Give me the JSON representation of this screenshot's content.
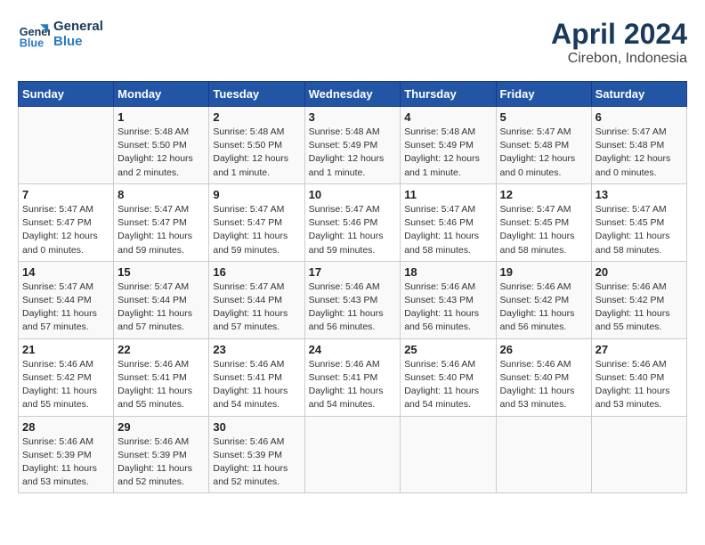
{
  "header": {
    "logo_line1": "General",
    "logo_line2": "Blue",
    "month": "April 2024",
    "location": "Cirebon, Indonesia"
  },
  "weekdays": [
    "Sunday",
    "Monday",
    "Tuesday",
    "Wednesday",
    "Thursday",
    "Friday",
    "Saturday"
  ],
  "weeks": [
    [
      {
        "day": "",
        "detail": ""
      },
      {
        "day": "1",
        "detail": "Sunrise: 5:48 AM\nSunset: 5:50 PM\nDaylight: 12 hours\nand 2 minutes."
      },
      {
        "day": "2",
        "detail": "Sunrise: 5:48 AM\nSunset: 5:50 PM\nDaylight: 12 hours\nand 1 minute."
      },
      {
        "day": "3",
        "detail": "Sunrise: 5:48 AM\nSunset: 5:49 PM\nDaylight: 12 hours\nand 1 minute."
      },
      {
        "day": "4",
        "detail": "Sunrise: 5:48 AM\nSunset: 5:49 PM\nDaylight: 12 hours\nand 1 minute."
      },
      {
        "day": "5",
        "detail": "Sunrise: 5:47 AM\nSunset: 5:48 PM\nDaylight: 12 hours\nand 0 minutes."
      },
      {
        "day": "6",
        "detail": "Sunrise: 5:47 AM\nSunset: 5:48 PM\nDaylight: 12 hours\nand 0 minutes."
      }
    ],
    [
      {
        "day": "7",
        "detail": "Sunrise: 5:47 AM\nSunset: 5:47 PM\nDaylight: 12 hours\nand 0 minutes."
      },
      {
        "day": "8",
        "detail": "Sunrise: 5:47 AM\nSunset: 5:47 PM\nDaylight: 11 hours\nand 59 minutes."
      },
      {
        "day": "9",
        "detail": "Sunrise: 5:47 AM\nSunset: 5:47 PM\nDaylight: 11 hours\nand 59 minutes."
      },
      {
        "day": "10",
        "detail": "Sunrise: 5:47 AM\nSunset: 5:46 PM\nDaylight: 11 hours\nand 59 minutes."
      },
      {
        "day": "11",
        "detail": "Sunrise: 5:47 AM\nSunset: 5:46 PM\nDaylight: 11 hours\nand 58 minutes."
      },
      {
        "day": "12",
        "detail": "Sunrise: 5:47 AM\nSunset: 5:45 PM\nDaylight: 11 hours\nand 58 minutes."
      },
      {
        "day": "13",
        "detail": "Sunrise: 5:47 AM\nSunset: 5:45 PM\nDaylight: 11 hours\nand 58 minutes."
      }
    ],
    [
      {
        "day": "14",
        "detail": "Sunrise: 5:47 AM\nSunset: 5:44 PM\nDaylight: 11 hours\nand 57 minutes."
      },
      {
        "day": "15",
        "detail": "Sunrise: 5:47 AM\nSunset: 5:44 PM\nDaylight: 11 hours\nand 57 minutes."
      },
      {
        "day": "16",
        "detail": "Sunrise: 5:47 AM\nSunset: 5:44 PM\nDaylight: 11 hours\nand 57 minutes."
      },
      {
        "day": "17",
        "detail": "Sunrise: 5:46 AM\nSunset: 5:43 PM\nDaylight: 11 hours\nand 56 minutes."
      },
      {
        "day": "18",
        "detail": "Sunrise: 5:46 AM\nSunset: 5:43 PM\nDaylight: 11 hours\nand 56 minutes."
      },
      {
        "day": "19",
        "detail": "Sunrise: 5:46 AM\nSunset: 5:42 PM\nDaylight: 11 hours\nand 56 minutes."
      },
      {
        "day": "20",
        "detail": "Sunrise: 5:46 AM\nSunset: 5:42 PM\nDaylight: 11 hours\nand 55 minutes."
      }
    ],
    [
      {
        "day": "21",
        "detail": "Sunrise: 5:46 AM\nSunset: 5:42 PM\nDaylight: 11 hours\nand 55 minutes."
      },
      {
        "day": "22",
        "detail": "Sunrise: 5:46 AM\nSunset: 5:41 PM\nDaylight: 11 hours\nand 55 minutes."
      },
      {
        "day": "23",
        "detail": "Sunrise: 5:46 AM\nSunset: 5:41 PM\nDaylight: 11 hours\nand 54 minutes."
      },
      {
        "day": "24",
        "detail": "Sunrise: 5:46 AM\nSunset: 5:41 PM\nDaylight: 11 hours\nand 54 minutes."
      },
      {
        "day": "25",
        "detail": "Sunrise: 5:46 AM\nSunset: 5:40 PM\nDaylight: 11 hours\nand 54 minutes."
      },
      {
        "day": "26",
        "detail": "Sunrise: 5:46 AM\nSunset: 5:40 PM\nDaylight: 11 hours\nand 53 minutes."
      },
      {
        "day": "27",
        "detail": "Sunrise: 5:46 AM\nSunset: 5:40 PM\nDaylight: 11 hours\nand 53 minutes."
      }
    ],
    [
      {
        "day": "28",
        "detail": "Sunrise: 5:46 AM\nSunset: 5:39 PM\nDaylight: 11 hours\nand 53 minutes."
      },
      {
        "day": "29",
        "detail": "Sunrise: 5:46 AM\nSunset: 5:39 PM\nDaylight: 11 hours\nand 52 minutes."
      },
      {
        "day": "30",
        "detail": "Sunrise: 5:46 AM\nSunset: 5:39 PM\nDaylight: 11 hours\nand 52 minutes."
      },
      {
        "day": "",
        "detail": ""
      },
      {
        "day": "",
        "detail": ""
      },
      {
        "day": "",
        "detail": ""
      },
      {
        "day": "",
        "detail": ""
      }
    ]
  ]
}
